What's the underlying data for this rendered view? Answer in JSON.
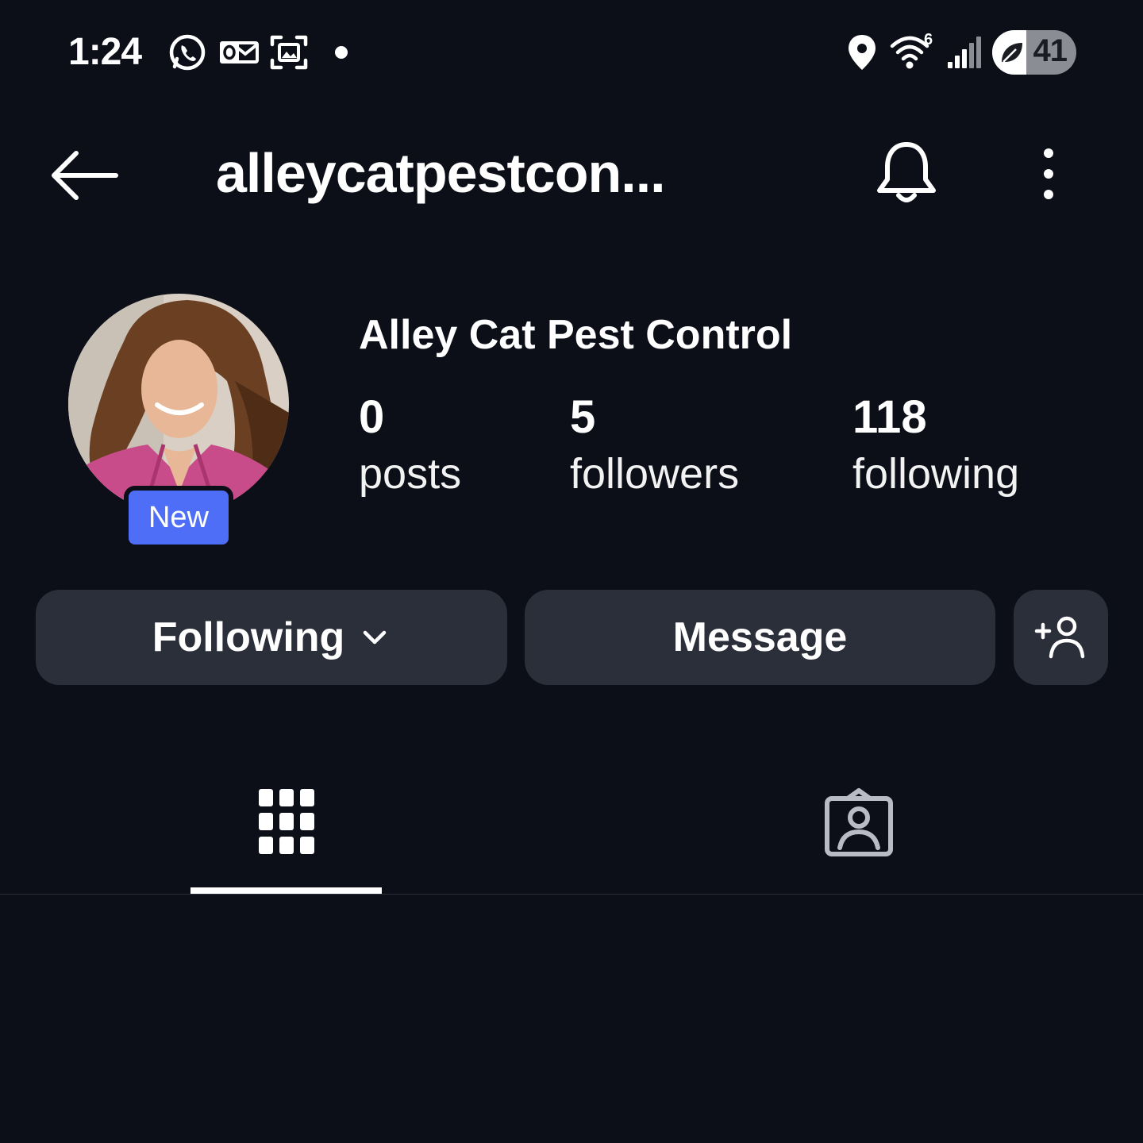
{
  "status_bar": {
    "time": "1:24",
    "notification_icons": [
      "whatsapp-icon",
      "outlook-icon",
      "screenshot-icon",
      "dot-icon"
    ],
    "system_icons": [
      "location-icon",
      "wifi-icon",
      "signal-icon"
    ],
    "wifi_badge": "6",
    "battery_level": "41",
    "battery_fraction": 0.41
  },
  "header": {
    "title": "alleycatpestcon...",
    "back_icon": "arrow-left-icon",
    "notification_icon": "bell-icon",
    "menu_icon": "more-vertical-icon"
  },
  "profile": {
    "display_name": "Alley Cat Pest Control",
    "badge": "New",
    "stats": [
      {
        "count": "0",
        "label": "posts"
      },
      {
        "count": "5",
        "label": "followers"
      },
      {
        "count": "118",
        "label": "following"
      }
    ]
  },
  "actions": {
    "following_label": "Following",
    "message_label": "Message",
    "add_person_icon": "add-person-icon"
  },
  "tabs": [
    {
      "icon": "grid-icon",
      "active": true
    },
    {
      "icon": "tagged-person-icon",
      "active": false
    }
  ],
  "colors": {
    "background": "#0c0f18",
    "button": "#2b2f3a",
    "badge": "#4f6ef7",
    "text": "#ffffff"
  }
}
